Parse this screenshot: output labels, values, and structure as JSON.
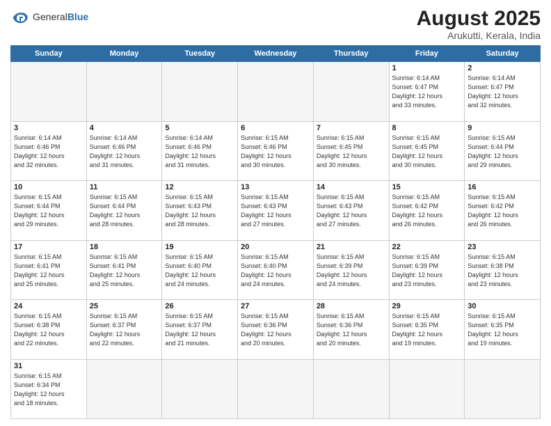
{
  "header": {
    "logo_general": "General",
    "logo_blue": "Blue",
    "month_year": "August 2025",
    "subtitle": "Arukutti, Kerala, India"
  },
  "weekdays": [
    "Sunday",
    "Monday",
    "Tuesday",
    "Wednesday",
    "Thursday",
    "Friday",
    "Saturday"
  ],
  "weeks": [
    [
      {
        "day": "",
        "info": ""
      },
      {
        "day": "",
        "info": ""
      },
      {
        "day": "",
        "info": ""
      },
      {
        "day": "",
        "info": ""
      },
      {
        "day": "",
        "info": ""
      },
      {
        "day": "1",
        "info": "Sunrise: 6:14 AM\nSunset: 6:47 PM\nDaylight: 12 hours\nand 33 minutes."
      },
      {
        "day": "2",
        "info": "Sunrise: 6:14 AM\nSunset: 6:47 PM\nDaylight: 12 hours\nand 32 minutes."
      }
    ],
    [
      {
        "day": "3",
        "info": "Sunrise: 6:14 AM\nSunset: 6:46 PM\nDaylight: 12 hours\nand 32 minutes."
      },
      {
        "day": "4",
        "info": "Sunrise: 6:14 AM\nSunset: 6:46 PM\nDaylight: 12 hours\nand 31 minutes."
      },
      {
        "day": "5",
        "info": "Sunrise: 6:14 AM\nSunset: 6:46 PM\nDaylight: 12 hours\nand 31 minutes."
      },
      {
        "day": "6",
        "info": "Sunrise: 6:15 AM\nSunset: 6:46 PM\nDaylight: 12 hours\nand 30 minutes."
      },
      {
        "day": "7",
        "info": "Sunrise: 6:15 AM\nSunset: 6:45 PM\nDaylight: 12 hours\nand 30 minutes."
      },
      {
        "day": "8",
        "info": "Sunrise: 6:15 AM\nSunset: 6:45 PM\nDaylight: 12 hours\nand 30 minutes."
      },
      {
        "day": "9",
        "info": "Sunrise: 6:15 AM\nSunset: 6:44 PM\nDaylight: 12 hours\nand 29 minutes."
      }
    ],
    [
      {
        "day": "10",
        "info": "Sunrise: 6:15 AM\nSunset: 6:44 PM\nDaylight: 12 hours\nand 29 minutes."
      },
      {
        "day": "11",
        "info": "Sunrise: 6:15 AM\nSunset: 6:44 PM\nDaylight: 12 hours\nand 28 minutes."
      },
      {
        "day": "12",
        "info": "Sunrise: 6:15 AM\nSunset: 6:43 PM\nDaylight: 12 hours\nand 28 minutes."
      },
      {
        "day": "13",
        "info": "Sunrise: 6:15 AM\nSunset: 6:43 PM\nDaylight: 12 hours\nand 27 minutes."
      },
      {
        "day": "14",
        "info": "Sunrise: 6:15 AM\nSunset: 6:43 PM\nDaylight: 12 hours\nand 27 minutes."
      },
      {
        "day": "15",
        "info": "Sunrise: 6:15 AM\nSunset: 6:42 PM\nDaylight: 12 hours\nand 26 minutes."
      },
      {
        "day": "16",
        "info": "Sunrise: 6:15 AM\nSunset: 6:42 PM\nDaylight: 12 hours\nand 26 minutes."
      }
    ],
    [
      {
        "day": "17",
        "info": "Sunrise: 6:15 AM\nSunset: 6:41 PM\nDaylight: 12 hours\nand 25 minutes."
      },
      {
        "day": "18",
        "info": "Sunrise: 6:15 AM\nSunset: 6:41 PM\nDaylight: 12 hours\nand 25 minutes."
      },
      {
        "day": "19",
        "info": "Sunrise: 6:15 AM\nSunset: 6:40 PM\nDaylight: 12 hours\nand 24 minutes."
      },
      {
        "day": "20",
        "info": "Sunrise: 6:15 AM\nSunset: 6:40 PM\nDaylight: 12 hours\nand 24 minutes."
      },
      {
        "day": "21",
        "info": "Sunrise: 6:15 AM\nSunset: 6:39 PM\nDaylight: 12 hours\nand 24 minutes."
      },
      {
        "day": "22",
        "info": "Sunrise: 6:15 AM\nSunset: 6:39 PM\nDaylight: 12 hours\nand 23 minutes."
      },
      {
        "day": "23",
        "info": "Sunrise: 6:15 AM\nSunset: 6:38 PM\nDaylight: 12 hours\nand 23 minutes."
      }
    ],
    [
      {
        "day": "24",
        "info": "Sunrise: 6:15 AM\nSunset: 6:38 PM\nDaylight: 12 hours\nand 22 minutes."
      },
      {
        "day": "25",
        "info": "Sunrise: 6:15 AM\nSunset: 6:37 PM\nDaylight: 12 hours\nand 22 minutes."
      },
      {
        "day": "26",
        "info": "Sunrise: 6:15 AM\nSunset: 6:37 PM\nDaylight: 12 hours\nand 21 minutes."
      },
      {
        "day": "27",
        "info": "Sunrise: 6:15 AM\nSunset: 6:36 PM\nDaylight: 12 hours\nand 20 minutes."
      },
      {
        "day": "28",
        "info": "Sunrise: 6:15 AM\nSunset: 6:36 PM\nDaylight: 12 hours\nand 20 minutes."
      },
      {
        "day": "29",
        "info": "Sunrise: 6:15 AM\nSunset: 6:35 PM\nDaylight: 12 hours\nand 19 minutes."
      },
      {
        "day": "30",
        "info": "Sunrise: 6:15 AM\nSunset: 6:35 PM\nDaylight: 12 hours\nand 19 minutes."
      }
    ],
    [
      {
        "day": "31",
        "info": "Sunrise: 6:15 AM\nSunset: 6:34 PM\nDaylight: 12 hours\nand 18 minutes."
      },
      {
        "day": "",
        "info": ""
      },
      {
        "day": "",
        "info": ""
      },
      {
        "day": "",
        "info": ""
      },
      {
        "day": "",
        "info": ""
      },
      {
        "day": "",
        "info": ""
      },
      {
        "day": "",
        "info": ""
      }
    ]
  ]
}
